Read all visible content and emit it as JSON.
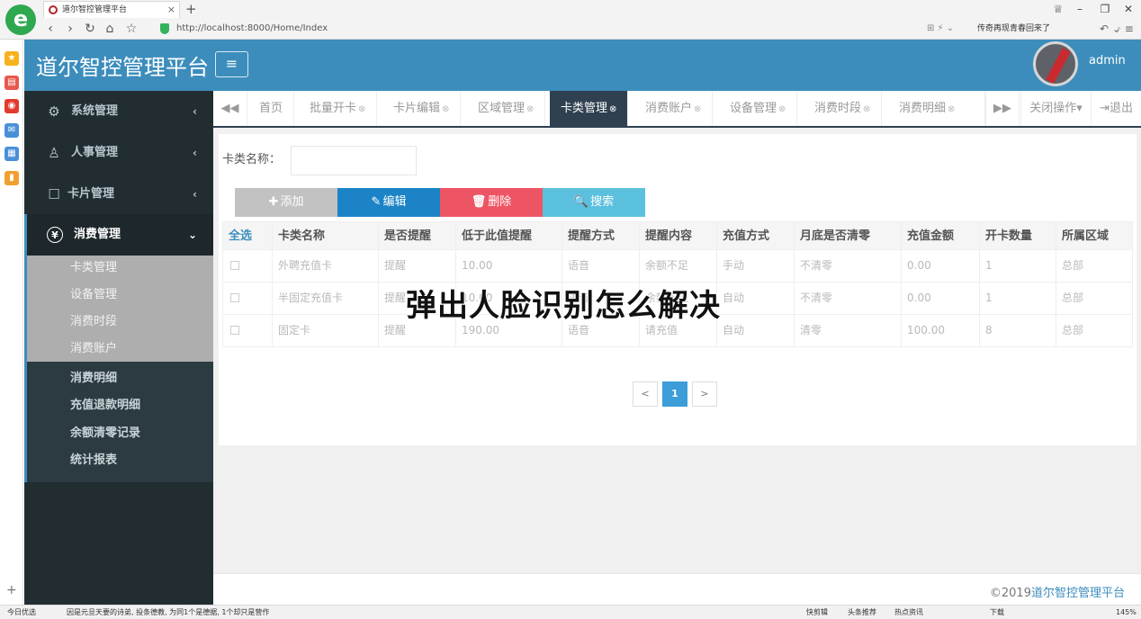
{
  "browser": {
    "logo_letter": "e",
    "tab_title": "道尔智控管理平台",
    "tab_close": "×",
    "new_tab": "+",
    "nav": {
      "back": "‹",
      "forward": "›",
      "reload": "↻",
      "home": "⌂",
      "favorite": "☆"
    },
    "url": "http://localhost:8000/Home/Index",
    "address_tools": "⊞ ⚡ ⌄",
    "search_hint": "传奇再现青春回来了",
    "search_icon": "⌕",
    "right_nav": "↶ ⌄  ≡",
    "window_controls": {
      "shirt": "♕",
      "min": "–",
      "max": "❐",
      "close": "✕"
    }
  },
  "side_strip": {
    "icons": [
      {
        "name": "favorites-star-icon",
        "glyph": "★",
        "color": "#f6b21a"
      },
      {
        "name": "notes-icon",
        "glyph": "▤",
        "color": "#e8584e"
      },
      {
        "name": "weibo-icon",
        "glyph": "◉",
        "color": "#e23b2e"
      },
      {
        "name": "mail-icon",
        "glyph": "✉",
        "color": "#4a90d9"
      },
      {
        "name": "document-icon",
        "glyph": "▦",
        "color": "#4a90d9"
      },
      {
        "name": "book-icon",
        "glyph": "▮",
        "color": "#f0a030"
      }
    ],
    "add": "+"
  },
  "header": {
    "title": "道尔智控管理平台",
    "menu_toggle": "≡",
    "user": "admin"
  },
  "sidebar": {
    "items": [
      {
        "label": "系统管理",
        "icon": "⚙",
        "chevron": "‹"
      },
      {
        "label": "人事管理",
        "icon": "♙",
        "chevron": "‹"
      },
      {
        "label": "卡片管理",
        "icon": "☐",
        "chevron": "‹"
      },
      {
        "label": "消费管理",
        "icon": "¥",
        "chevron": "⌄"
      }
    ],
    "submenu_a": [
      "卡类管理",
      "设备管理",
      "消费时段",
      "消费账户"
    ],
    "submenu_b": [
      "消费明细",
      "充值退款明细",
      "余额清零记录",
      "统计报表"
    ]
  },
  "tabs": {
    "prev": "◀◀",
    "next": "▶▶",
    "items": [
      {
        "label": "首页",
        "close": ""
      },
      {
        "label": "批量开卡",
        "close": "⊗"
      },
      {
        "label": "卡片编辑",
        "close": "⊗"
      },
      {
        "label": "区域管理",
        "close": "⊗"
      },
      {
        "label": "卡类管理",
        "close": "⊗"
      },
      {
        "label": "消费账户",
        "close": "⊗"
      },
      {
        "label": "设备管理",
        "close": "⊗"
      },
      {
        "label": "消费时段",
        "close": "⊗"
      },
      {
        "label": "消费明细",
        "close": "⊗"
      }
    ],
    "close_ops": "关闭操作▾",
    "logout": "⇥退出"
  },
  "search": {
    "label": "卡类名称：",
    "value": ""
  },
  "toolbar": {
    "add": {
      "icon": "✚",
      "label": "添加",
      "color": "#c2c2c2"
    },
    "edit": {
      "icon": "✎",
      "label": "编辑",
      "color": "#1c84c6"
    },
    "delete": {
      "icon": "🗑",
      "label": "删除",
      "color": "#ed5565"
    },
    "search": {
      "icon": "🔍",
      "label": "搜索",
      "color": "#5bc0de"
    }
  },
  "table": {
    "select_all": "全选",
    "columns": [
      "卡类名称",
      "是否提醒",
      "低于此值提醒",
      "提醒方式",
      "提醒内容",
      "充值方式",
      "月底是否清零",
      "充值金额",
      "开卡数量",
      "所属区域"
    ],
    "rows": [
      [
        "外聘充值卡",
        "提醒",
        "10.00",
        "语音",
        "余额不足",
        "手动",
        "不清零",
        "0.00",
        "1",
        "总部"
      ],
      [
        "半固定充值卡",
        "提醒",
        "10.00",
        "语音",
        "余额不足",
        "自动",
        "不清零",
        "0.00",
        "1",
        "总部"
      ],
      [
        "固定卡",
        "提醒",
        "190.00",
        "语音",
        "请充值",
        "自动",
        "清零",
        "100.00",
        "8",
        "总部"
      ]
    ]
  },
  "pagination": {
    "prev": "<",
    "current": "1",
    "next": ">"
  },
  "overlay_caption": "弹出人脸识别怎么解决",
  "footer": {
    "copyright": "©2019",
    "brand": "道尔智控管理平台"
  },
  "status": {
    "today": "今日优选",
    "news": "因是元旦天要的诗弟, 投条德教, 为同1个是德据, 1个却只是营作",
    "quick": "快剪辑",
    "headline": "头条推荐",
    "hot": "热点资讯",
    "download": "下载",
    "zoom": "145%"
  }
}
